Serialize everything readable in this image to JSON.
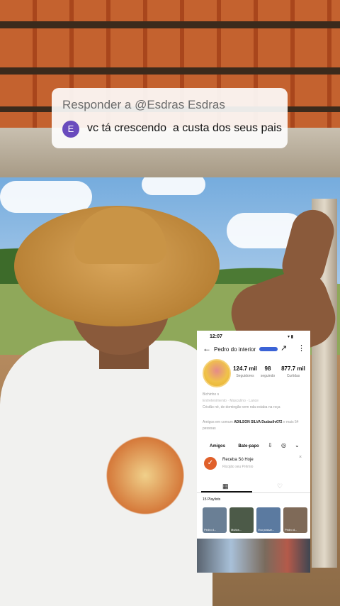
{
  "reply": {
    "title": "Responder a @Esdras Esdras",
    "avatar_letter": "E",
    "comment": "vc tá crescendo  a custa dos seus pais"
  },
  "phone": {
    "time": "12:07",
    "status_icons": "▾ ▮",
    "back_icon": "←",
    "profile_name": "Pedro do interior",
    "share_icon": "↗",
    "more_icon": "⋮",
    "stats": [
      {
        "num": "124.7 mil",
        "label": "Seguidores"
      },
      {
        "num": "98",
        "label": "seguindo"
      },
      {
        "num": "877.7 mil",
        "label": "Curtidas"
      }
    ],
    "bio_lines": [
      "Bichinho s",
      "Entretenimento · Masculino · Lance",
      "Cristão né, de domingão vem nda estaba na roça"
    ],
    "mentions_prefix": "Amigos em comum",
    "mentions_names": "ADILSON SILVA  Dudasilv072",
    "mentions_suffix": "e mais 54 pessoas",
    "buttons": {
      "friends": "Amigos",
      "chat": "Bate-papo"
    },
    "promo": {
      "title": "Receba Só Hoje",
      "subtitle": "Ricojão seu Prêmio",
      "icon": "✓",
      "close": "×"
    },
    "tab_grid_icon": "▦",
    "tab_heart_icon": "♡",
    "playlists_label": "15 Playlists",
    "thumb_captions": [
      "Pedro d...",
      "Muitos...",
      "Vou passar...",
      "Pedro d..."
    ]
  },
  "colors": {
    "badge": "#3b63d6",
    "reply_avatar": "#6a4bbd",
    "promo": "#e0602a"
  }
}
